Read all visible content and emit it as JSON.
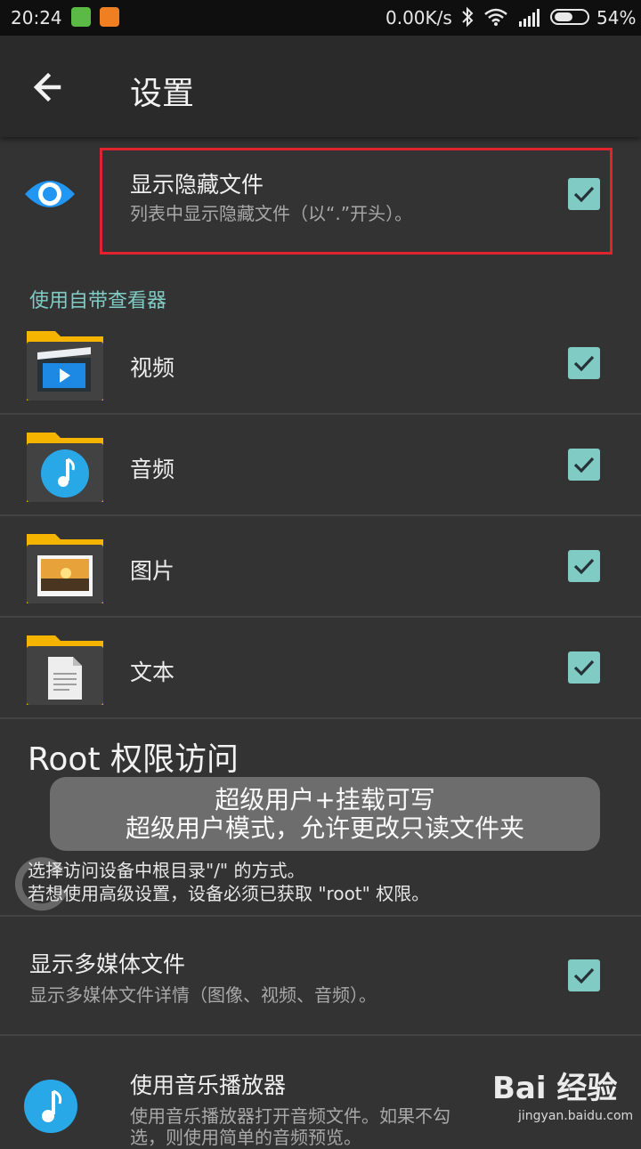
{
  "status_bar": {
    "time": "20:24",
    "network_speed": "0.00K/s",
    "battery": "54%",
    "icons": [
      "app-notification-icon",
      "mi-app-icon",
      "bluetooth-icon",
      "wifi-icon",
      "signal-icon",
      "battery-icon"
    ]
  },
  "appbar": {
    "title": "设置",
    "back_icon": "arrow-left-icon"
  },
  "settings": {
    "hidden_files": {
      "title": "显示隐藏文件",
      "subtitle": "列表中显示隐藏文件（以“.”开头）。",
      "checked": true,
      "icon": "eye-icon"
    },
    "viewer_section": {
      "header": "使用自带查看器",
      "items": [
        {
          "label": "视频",
          "icon": "video-folder-icon",
          "checked": true
        },
        {
          "label": "音频",
          "icon": "audio-folder-icon",
          "checked": true
        },
        {
          "label": "图片",
          "icon": "image-folder-icon",
          "checked": true
        },
        {
          "label": "文本",
          "icon": "text-folder-icon",
          "checked": true
        }
      ]
    },
    "root": {
      "header": "Root 权限访问",
      "desc_line1": "选择访问设备中根目录\"/\" 的方式。",
      "desc_line2": "若想使用高级设置，设备必须已获取 \"root\" 权限。"
    },
    "multimedia": {
      "title": "显示多媒体文件",
      "subtitle": "显示多媒体文件详情（图像、视频、音频）。",
      "checked": true
    },
    "music_player": {
      "title": "使用音乐播放器",
      "subtitle_line1": "使用音乐播放器打开音频文件。如果不勾",
      "subtitle_line2": "选，则使用简单的音频预览。",
      "icon": "music-note-icon"
    }
  },
  "toast": {
    "line1": "超级用户+挂载可写",
    "line2": "超级用户模式，允许更改只读文件夹"
  },
  "watermark": {
    "brand": "Bai 经验",
    "url": "jingyan.baidu.com"
  },
  "colors": {
    "accent": "#80cbc4",
    "background": "#333333",
    "appbar": "#2a2a2a",
    "highlight": "#e0242f"
  }
}
